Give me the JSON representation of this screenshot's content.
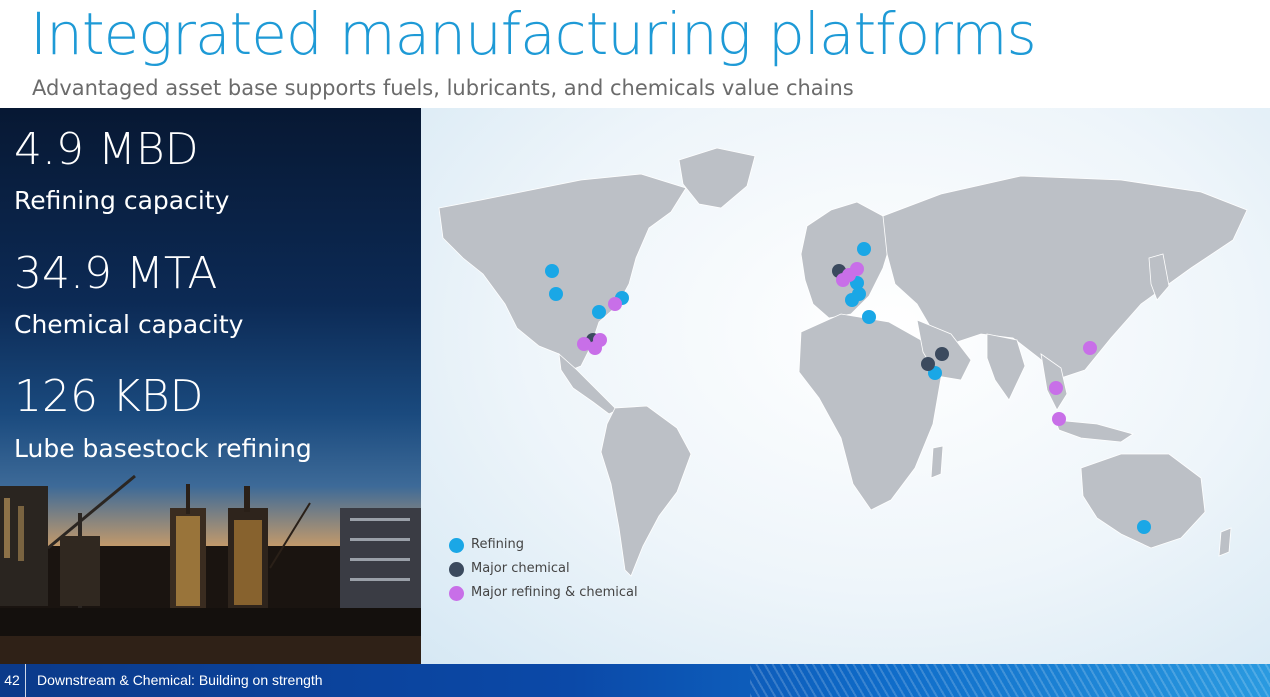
{
  "header": {
    "title": "Integrated manufacturing platforms",
    "subtitle": "Advantaged asset base supports fuels, lubricants, and chemicals value chains"
  },
  "stats": [
    {
      "value": "4.9 MBD",
      "label": "Refining capacity"
    },
    {
      "value": "34.9 MTA",
      "label": "Chemical capacity"
    },
    {
      "value": "126 KBD",
      "label": "Lube basestock refining"
    }
  ],
  "legend": [
    {
      "label": "Refining",
      "color": "#1aa7e6"
    },
    {
      "label": "Major chemical",
      "color": "#3b4a5e"
    },
    {
      "label": "Major refining & chemical",
      "color": "#c86fe8"
    }
  ],
  "colors": {
    "title": "#1e9ad6",
    "land": "#bcc0c6",
    "refining": "#1aa7e6",
    "chemical": "#3b4a5e",
    "refining_chemical": "#c86fe8"
  },
  "footer": {
    "page_number": "42",
    "text": "Downstream & Chemical:  Building on strength"
  }
}
